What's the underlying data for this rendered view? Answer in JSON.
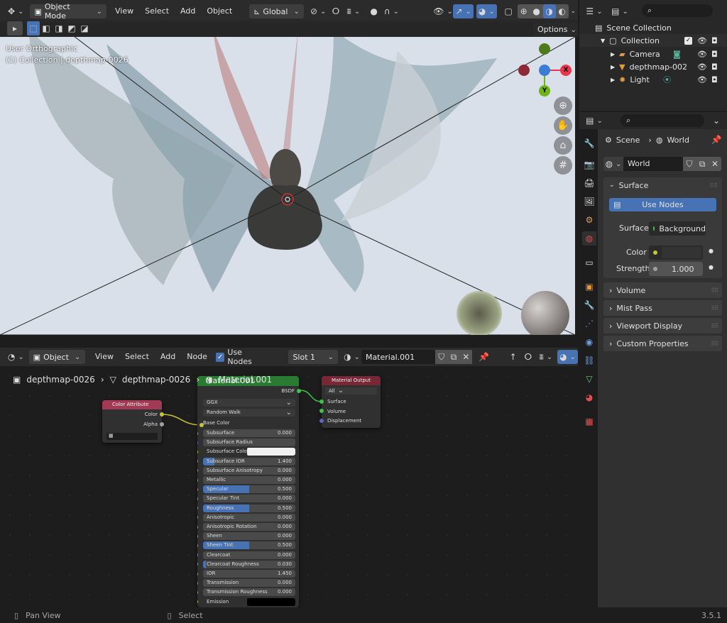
{
  "viewport": {
    "mode": "Object Mode",
    "menus": [
      "View",
      "Select",
      "Add",
      "Object"
    ],
    "transform_orientation": "Global",
    "options_label": "Options",
    "view_name": "User Orthographic",
    "object_info": "(1) Collection | depthmap-0026",
    "gizmo": {
      "x": "X",
      "y": "Y",
      "z": ""
    }
  },
  "outliner": {
    "scene_collection": "Scene Collection",
    "collection": "Collection",
    "items": [
      "Camera",
      "depthmap-002",
      "Light"
    ]
  },
  "properties": {
    "breadcrumb_scene": "Scene",
    "breadcrumb_world": "World",
    "world_name": "World",
    "surface_panel": "Surface",
    "use_nodes_label": "Use Nodes",
    "surface_label": "Surface",
    "surface_value": "Background",
    "color_label": "Color",
    "strength_label": "Strength",
    "strength_value": "1.000",
    "collapsed_panels": [
      "Volume",
      "Mist Pass",
      "Viewport Display",
      "Custom Properties"
    ]
  },
  "node_editor": {
    "mode": "Object",
    "menus": [
      "View",
      "Select",
      "Add",
      "Node"
    ],
    "use_nodes_label": "Use Nodes",
    "use_nodes_checked": true,
    "slot": "Slot 1",
    "material": "Material.001",
    "breadcrumb": [
      "depthmap-0026",
      "depthmap-0026",
      "Material.001"
    ]
  },
  "nodes": {
    "color_attribute": {
      "title": "Color Attribute",
      "out_color": "Color",
      "out_alpha": "Alpha"
    },
    "bsdf": {
      "title": "Material.001",
      "out": "BSDF",
      "distribution": "GGX",
      "subsurface_method": "Random Walk",
      "base_color": "Base Color",
      "props": [
        {
          "label": "Subsurface",
          "value": "0.000",
          "fill": 0
        },
        {
          "label": "Subsurface Radius",
          "value": "",
          "fill": 0
        },
        {
          "label": "Subsurface Color",
          "value": "",
          "fill": 0
        },
        {
          "label": "Subsurface IOR",
          "value": "1.400",
          "fill": 0.12
        },
        {
          "label": "Subsurface Anisotropy",
          "value": "0.000",
          "fill": 0
        },
        {
          "label": "Metallic",
          "value": "0.000",
          "fill": 0
        },
        {
          "label": "Specular",
          "value": "0.500",
          "fill": 0.5
        },
        {
          "label": "Specular Tint",
          "value": "0.000",
          "fill": 0
        },
        {
          "label": "Roughness",
          "value": "0.500",
          "fill": 0.5
        },
        {
          "label": "Anisotropic",
          "value": "0.000",
          "fill": 0
        },
        {
          "label": "Anisotropic Rotation",
          "value": "0.000",
          "fill": 0
        },
        {
          "label": "Sheen",
          "value": "0.000",
          "fill": 0
        },
        {
          "label": "Sheen Tint",
          "value": "0.500",
          "fill": 0.5
        },
        {
          "label": "Clearcoat",
          "value": "0.000",
          "fill": 0
        },
        {
          "label": "Clearcoat Roughness",
          "value": "0.030",
          "fill": 0.03
        },
        {
          "label": "IOR",
          "value": "1.450",
          "fill": 0
        },
        {
          "label": "Transmission",
          "value": "0.000",
          "fill": 0
        },
        {
          "label": "Transmission Roughness",
          "value": "0.000",
          "fill": 0
        },
        {
          "label": "Emission",
          "value": "",
          "fill": 0
        }
      ]
    },
    "material_output": {
      "title": "Material Output",
      "target": "All",
      "surface": "Surface",
      "volume": "Volume",
      "displacement": "Displacement"
    }
  },
  "statusbar": {
    "pan": "Pan View",
    "select": "Select",
    "version": "3.5.1"
  },
  "colors": {
    "accent": "#4772b3",
    "x_axis": "#e8364b",
    "y_axis": "#6fb51a",
    "z_axis": "#3b7cd6",
    "node_shader": "#2a7a33",
    "node_input": "#a33a55",
    "node_output": "#7a2735"
  }
}
